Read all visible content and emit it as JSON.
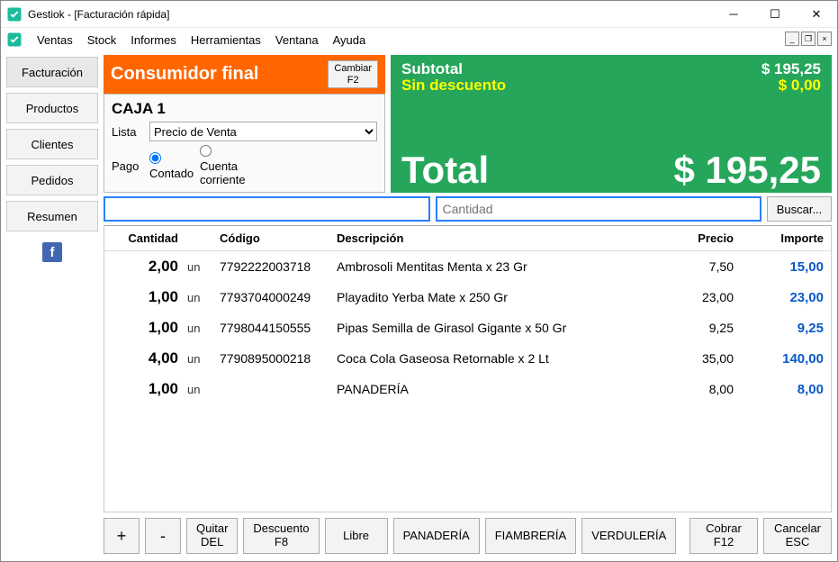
{
  "window": {
    "title": "Gestiok - [Facturación rápida]"
  },
  "menu": [
    "Ventas",
    "Stock",
    "Informes",
    "Herramientas",
    "Ventana",
    "Ayuda"
  ],
  "sidebar": {
    "items": [
      "Facturación",
      "Productos",
      "Clientes",
      "Pedidos",
      "Resumen"
    ]
  },
  "customer": {
    "name": "Consumidor final",
    "change_label": "Cambiar\nF2"
  },
  "cash": {
    "caja": "CAJA 1",
    "lista_label": "Lista",
    "lista_value": "Precio de Venta",
    "pago_label": "Pago",
    "pago_contado": "Contado",
    "pago_cc": "Cuenta corriente"
  },
  "totals": {
    "subtotal_label": "Subtotal",
    "subtotal": "$ 195,25",
    "discount_label": "Sin descuento",
    "discount": "$ 0,00",
    "total_label": "Total",
    "total": "$ 195,25"
  },
  "search": {
    "qty_placeholder": "Cantidad",
    "button": "Buscar..."
  },
  "table": {
    "headers": {
      "qty": "Cantidad",
      "code": "Código",
      "desc": "Descripción",
      "price": "Precio",
      "amount": "Importe"
    },
    "unit": "un",
    "rows": [
      {
        "qty": "2,00",
        "code": "7792222003718",
        "desc": "Ambrosoli Mentitas Menta x 23 Gr",
        "price": "7,50",
        "amount": "15,00"
      },
      {
        "qty": "1,00",
        "code": "7793704000249",
        "desc": "Playadito Yerba Mate x 250 Gr",
        "price": "23,00",
        "amount": "23,00"
      },
      {
        "qty": "1,00",
        "code": "7798044150555",
        "desc": "Pipas Semilla de Girasol Gigante x 50 Gr",
        "price": "9,25",
        "amount": "9,25"
      },
      {
        "qty": "4,00",
        "code": "7790895000218",
        "desc": "Coca Cola Gaseosa Retornable x 2 Lt",
        "price": "35,00",
        "amount": "140,00"
      },
      {
        "qty": "1,00",
        "code": "",
        "desc": "PANADERÍA",
        "price": "8,00",
        "amount": "8,00"
      }
    ]
  },
  "bottom": {
    "plus": "+",
    "minus": "-",
    "quitar": "Quitar\nDEL",
    "descuento": "Descuento\nF8",
    "libre": "Libre",
    "cat1": "PANADERÍA",
    "cat2": "FIAMBRERÍA",
    "cat3": "VERDULERÍA",
    "cobrar": "Cobrar\nF12",
    "cancelar": "Cancelar\nESC"
  }
}
